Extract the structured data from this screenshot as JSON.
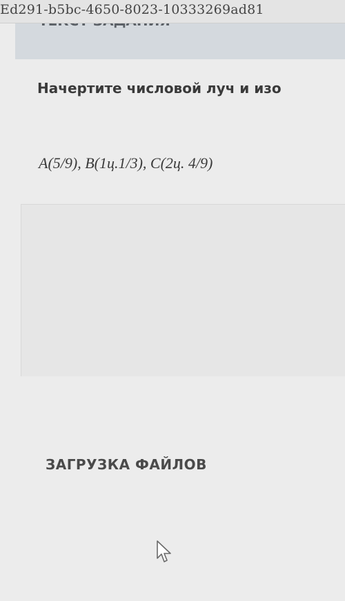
{
  "browser": {
    "url_fragment": "Ed291-b5bc-4650-8023-10333269ad81"
  },
  "task": {
    "header_title": "ТЕКСТ ЗАДАНИЯ",
    "question": "Начертите числовой луч и изо",
    "points": "A(5/9), B(1ц.1/3), C(2ц. 4/9)"
  },
  "upload": {
    "label": "ЗАГРУЗКА ФАЙЛОВ"
  },
  "icons": {
    "cursor": "mouse-pointer-icon"
  }
}
